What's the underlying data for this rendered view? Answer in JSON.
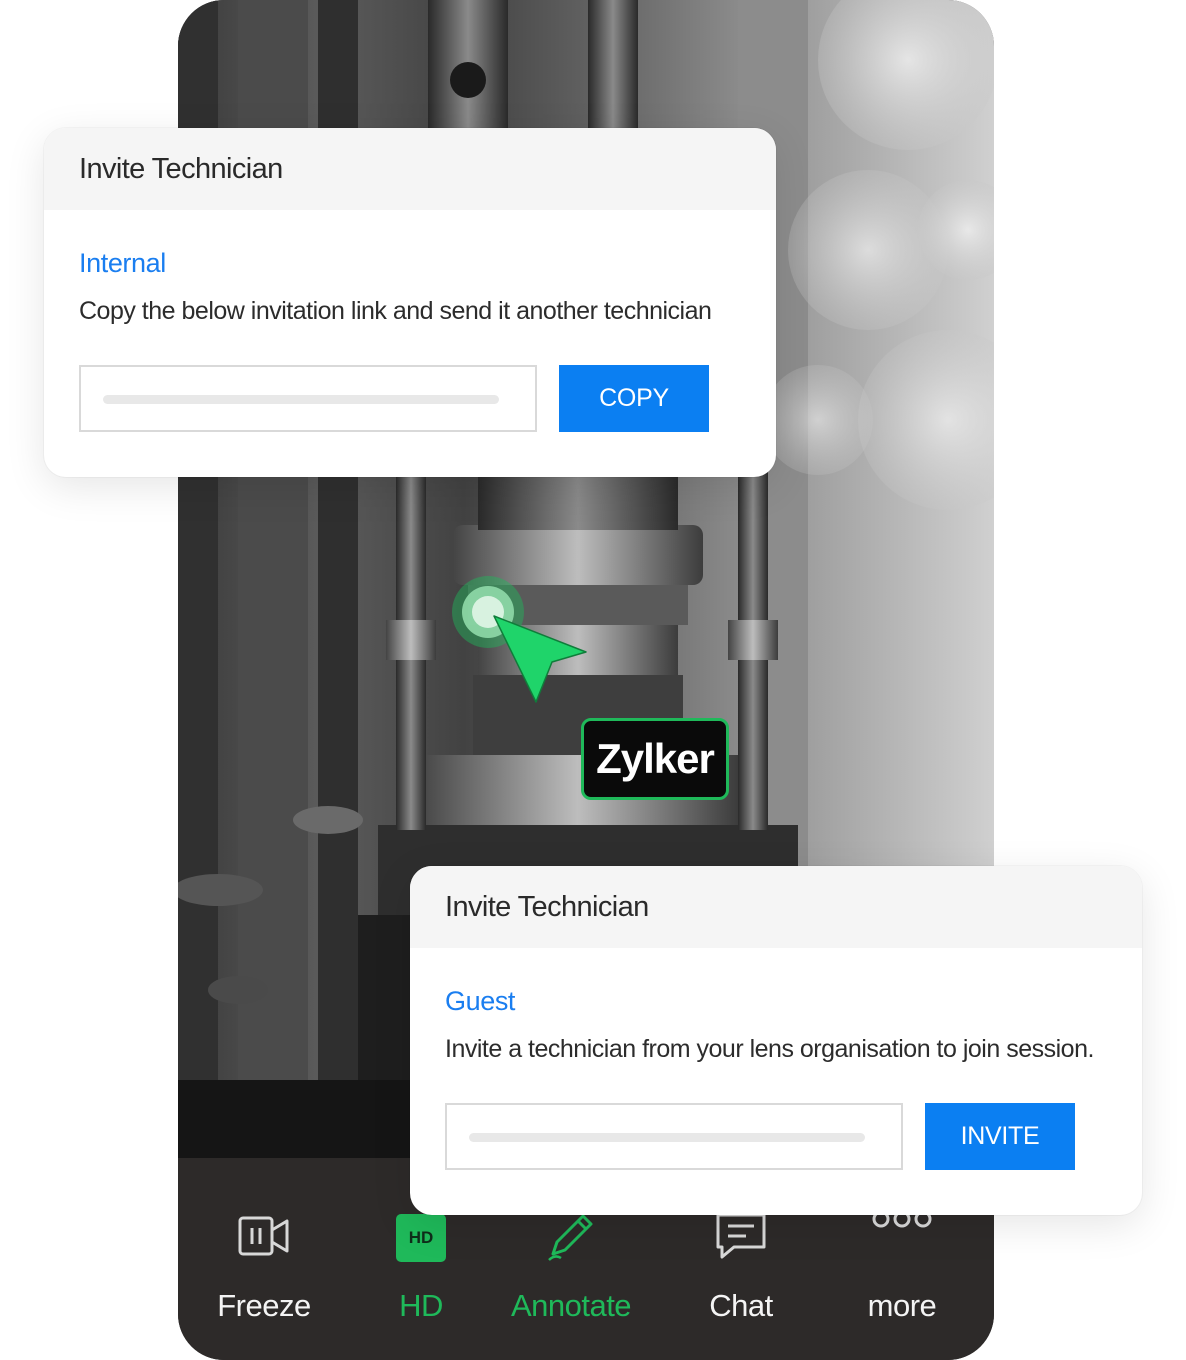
{
  "internal_card": {
    "title": "Invite Technician",
    "section": "Internal",
    "description": "Copy the below invitation link and send it another technician",
    "input_value": "",
    "button_label": "COPY"
  },
  "guest_card": {
    "title": "Invite Technician",
    "section": "Guest",
    "description": "Invite a technician from your lens organisation to join session.",
    "input_value": "",
    "button_label": "INVITE"
  },
  "pointer_label": "Zylker",
  "toolbar": {
    "items": [
      {
        "label": "Freeze",
        "icon": "freeze-video-icon",
        "active": false
      },
      {
        "label": "HD",
        "icon": "hd-icon",
        "badge": "HD",
        "active": true
      },
      {
        "label": "Annotate",
        "icon": "pen-icon",
        "active": true
      },
      {
        "label": "Chat",
        "icon": "chat-bubble-icon",
        "active": false
      },
      {
        "label": "more",
        "icon": "more-dots-icon",
        "active": false
      }
    ]
  },
  "colors": {
    "accent_blue": "#0b7ff2",
    "active_green": "#1fb95a",
    "toolbar_bg": "#2d2a29"
  }
}
